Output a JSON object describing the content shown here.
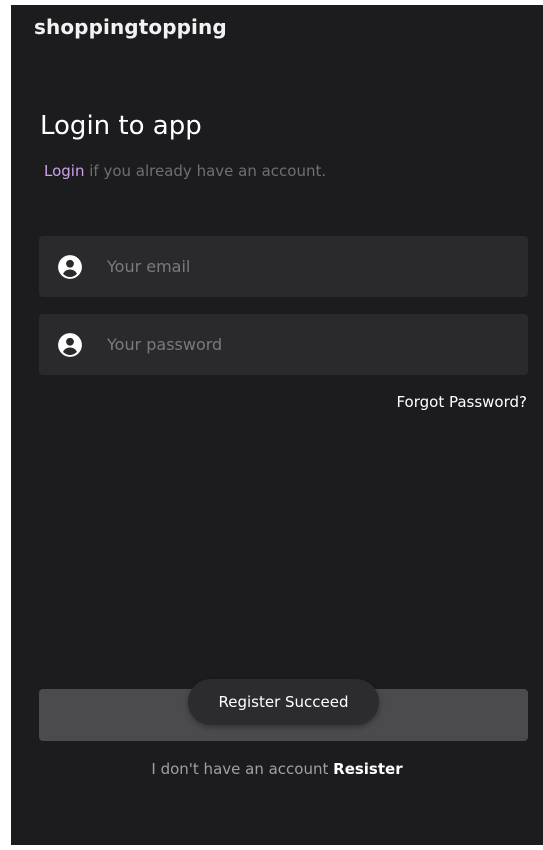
{
  "app": {
    "title": "shoppingtopping"
  },
  "login": {
    "title": "Login to app",
    "subtitle_link": "Login",
    "subtitle_rest": " if you already have an account."
  },
  "form": {
    "email_placeholder": "Your email",
    "email_value": "",
    "password_placeholder": "Your password",
    "password_value": "",
    "forgot_label": "Forgot Password?",
    "submit_label": ""
  },
  "toast": {
    "message": "Register Succeed"
  },
  "footer": {
    "prompt": "I don't have an account ",
    "register_link": "Resister"
  },
  "icons": {
    "email": "account-circle-icon",
    "password": "account-circle-icon"
  },
  "colors": {
    "background": "#1c1c1e",
    "field": "#2a2a2c",
    "accent": "#c9a2e6",
    "button": "#4b4b4e",
    "toast": "#2c2c2e"
  }
}
